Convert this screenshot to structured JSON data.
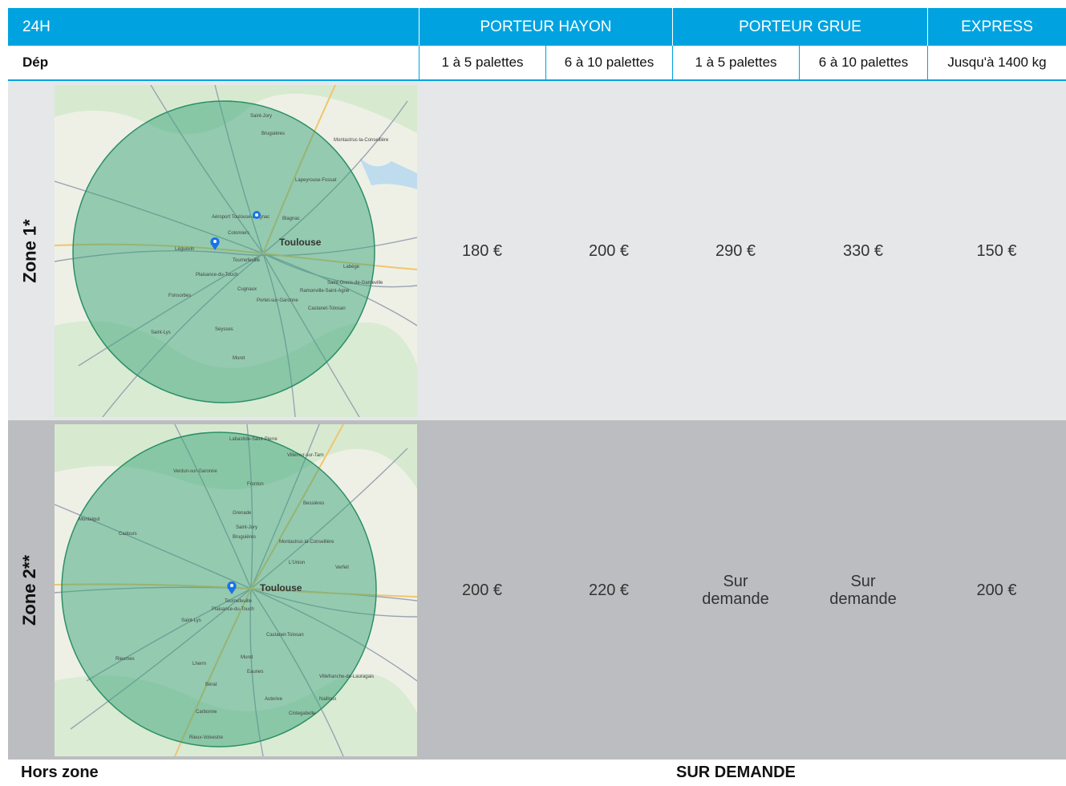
{
  "header": {
    "col_24h": "24H",
    "porteur_hayon": "PORTEUR HAYON",
    "porteur_grue": "PORTEUR GRUE",
    "express": "EXPRESS"
  },
  "subheader": {
    "dep": "Dép",
    "hayon_1_5": "1 à 5 palettes",
    "hayon_6_10": "6 à 10 palettes",
    "grue_1_5": "1 à 5 palettes",
    "grue_6_10": "6 à 10 palettes",
    "express_weight": "Jusqu'à 1400 kg"
  },
  "zones": [
    {
      "label": "Zone 1*",
      "map_city": "Toulouse",
      "map_towns": [
        "Aéroport Toulouse-Blagnac",
        "Blagnac",
        "Colomiers",
        "Léguevin",
        "Tournefeuille",
        "Plaisance-du-Touch",
        "Fonsorbes",
        "Muret",
        "Saint-Jory",
        "Bruguières",
        "Castanet-Tolosan",
        "Lapeyrouse-Fossat",
        "Montastruc-la-Conseillère",
        "Saint-Orens-de-Gameville",
        "Ramonville-Saint-Agne",
        "Cugnaux",
        "Portet-sur-Garonne",
        "Seysses",
        "Saint-Lys",
        "Labège"
      ],
      "prices": [
        "180 €",
        "200 €",
        "290 €",
        "330 €",
        "150 €"
      ]
    },
    {
      "label": "Zone 2**",
      "map_city": "Toulouse",
      "map_towns": [
        "Labastide-Saint-Pierre",
        "Villemur-sur-Tarn",
        "Verdun-sur-Garonne",
        "Fronton",
        "Grenade",
        "Cadours",
        "Montaigut",
        "Bessières",
        "Saint-Jory",
        "Bruguières",
        "Montastruc-la-Conseillère",
        "L'Union",
        "Verfeil",
        "Tournefeuille",
        "Plaisance-du-Touch",
        "Castanet-Tolosan",
        "Muret",
        "Eaunes",
        "Auterive",
        "Carbonne",
        "Rieux-Volvestre",
        "Villefranche-de-Lauragais",
        "Nailloux",
        "Cintegabelle",
        "Saint-Lys",
        "Rieumes",
        "Lherm",
        "Bérat"
      ],
      "prices": [
        "200 €",
        "220 €",
        "Sur\ndemande",
        "Sur\ndemande",
        "200 €"
      ]
    }
  ],
  "footer": {
    "label": "Hors zone",
    "value": "SUR DEMANDE"
  },
  "colors": {
    "header_blue": "#00a3e0",
    "zone1_bg": "#e6e7e9",
    "zone2_bg": "#bcbdc0",
    "map_circle": "#3aa37a"
  },
  "icons": [
    "location-pin-icon",
    "airport-icon"
  ]
}
